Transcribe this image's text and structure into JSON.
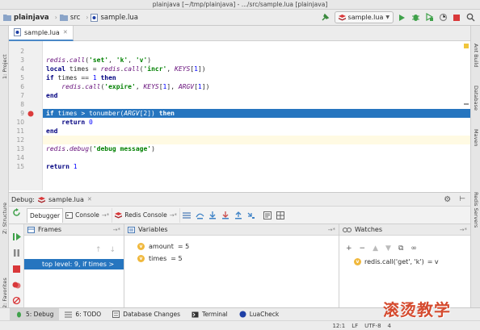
{
  "window": {
    "title": "plainjava [~/tmp/plainjava] - .../src/sample.lua [plainjava]"
  },
  "navbar": {
    "project": "plainjava",
    "folder": "src",
    "file": "sample.lua",
    "run_config": "sample.lua"
  },
  "left_stripe": {
    "project": "1: Project",
    "structure": "Z: Structure",
    "favorites": "2: Favorites"
  },
  "right_stripe": {
    "ant": "Ant Build",
    "database": "Database",
    "maven": "Maven",
    "redis": "Redis Servers"
  },
  "editor": {
    "tab": "sample.lua",
    "line_numbers": [
      "2",
      "3",
      "4",
      "5",
      "6",
      "7",
      "8",
      "9",
      "10",
      "11",
      "12",
      "13",
      "14",
      "15"
    ],
    "breakpoint_line": "9",
    "current_line": "9"
  },
  "debug": {
    "title": "Debug:",
    "session": "sample.lua",
    "tabs": {
      "debugger": "Debugger",
      "console": "Console",
      "redis_console": "Redis Console"
    },
    "frames": {
      "title": "Frames",
      "selected": "top level: 9, if times >"
    },
    "variables": {
      "title": "Variables",
      "items": [
        {
          "name": "amount",
          "value": "= 5"
        },
        {
          "name": "times",
          "value": "= 5"
        }
      ]
    },
    "watches": {
      "title": "Watches",
      "items": [
        {
          "expr": "redis.call('get', 'k')",
          "value": "= v"
        }
      ]
    }
  },
  "bottom_tabs": {
    "debug": "5: Debug",
    "todo": "6: TODO",
    "db_changes": "Database Changes",
    "terminal": "Terminal",
    "luacheck": "LuaCheck"
  },
  "status": {
    "position": "12:1",
    "line_sep": "LF",
    "encoding": "UTF-8",
    "indent": "4"
  },
  "watermark": "滚烫教学",
  "colors": {
    "selection": "#2675bf",
    "breakpoint": "#db3b3b",
    "run_green": "#3fa14a",
    "stop_red": "#d9383a",
    "accent": "#4a88c7"
  }
}
